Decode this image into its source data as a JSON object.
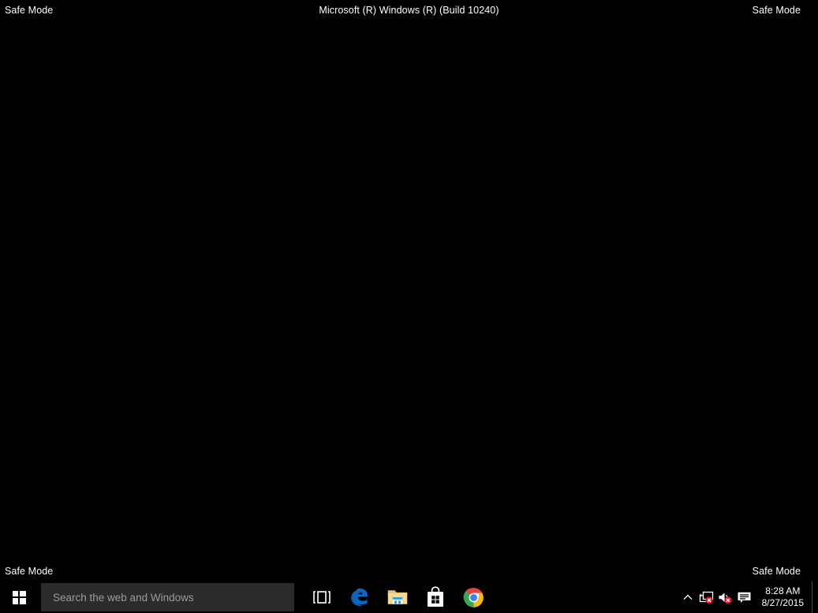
{
  "watermarks": {
    "top_left": "Safe Mode",
    "top_center": "Microsoft (R) Windows (R) (Build 10240)",
    "top_right": "Safe Mode",
    "bottom_left": "Safe Mode",
    "bottom_right": "Safe Mode"
  },
  "desktop": {
    "background_color": "#000000",
    "icons": []
  },
  "taskbar": {
    "background_color": "#000000",
    "start": {
      "label": "Start",
      "icon": "windows-logo-icon"
    },
    "search": {
      "placeholder": "Search the web and Windows",
      "value": "",
      "background_color": "#2b2b2b",
      "placeholder_color": "#9b9b9b"
    },
    "pinned_apps": [
      {
        "name": "Task View",
        "icon": "task-view-icon"
      },
      {
        "name": "Microsoft Edge",
        "icon": "edge-icon",
        "color": "#0c66c2"
      },
      {
        "name": "File Explorer",
        "icon": "file-explorer-icon",
        "color": "#f5d78a"
      },
      {
        "name": "Store",
        "icon": "store-icon",
        "color": "#ffffff"
      },
      {
        "name": "Google Chrome",
        "icon": "chrome-icon",
        "color": "#4285f4"
      }
    ],
    "tray": {
      "items": [
        {
          "name": "Show hidden icons",
          "icon": "chevron-up-icon"
        },
        {
          "name": "Network",
          "icon": "network-icon",
          "badge": "error-x",
          "badge_color": "#e81123"
        },
        {
          "name": "Volume",
          "icon": "speaker-icon",
          "badge": "error-x",
          "badge_color": "#e81123"
        },
        {
          "name": "Action Center",
          "icon": "action-center-icon"
        }
      ],
      "clock": {
        "time": "8:28 AM",
        "date": "8/27/2015"
      },
      "show_desktop": {
        "name": "Show desktop"
      }
    }
  }
}
